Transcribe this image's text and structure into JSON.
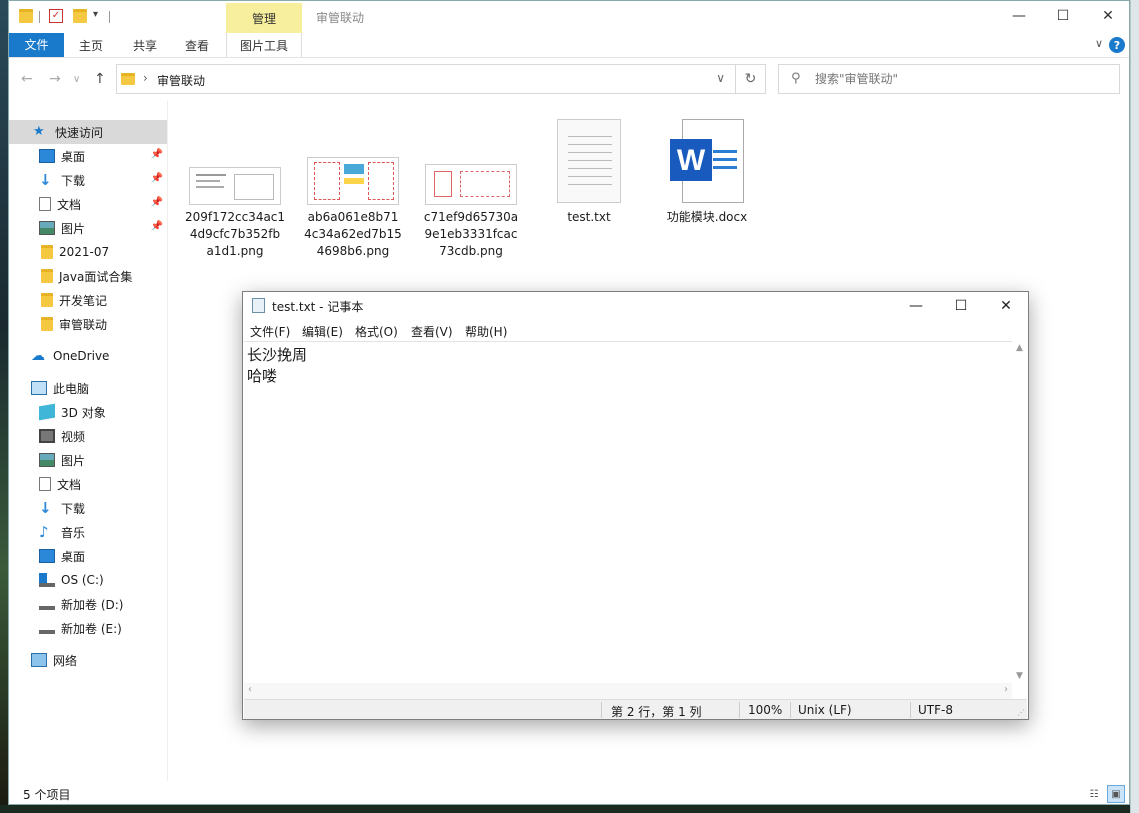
{
  "window": {
    "title": "审管联动",
    "manage_tab": "管理"
  },
  "ribbon": {
    "tabs": [
      "文件",
      "主页",
      "共享",
      "查看",
      "图片工具"
    ]
  },
  "address": {
    "crumb": "审管联动",
    "search_placeholder": "搜索\"审管联动\""
  },
  "nav": {
    "quick_access": "快速访问",
    "quick_items": [
      "桌面",
      "下载",
      "文档",
      "图片",
      "2021-07",
      "Java面试合集",
      "开发笔记",
      "审管联动"
    ],
    "onedrive": "OneDrive",
    "this_pc": "此电脑",
    "pc_items": [
      "3D 对象",
      "视频",
      "图片",
      "文档",
      "下载",
      "音乐",
      "桌面",
      "OS (C:)",
      "新加卷 (D:)",
      "新加卷 (E:)"
    ],
    "network": "网络"
  },
  "files": [
    {
      "name": "209f172cc34ac1\n4d9cfc7b352fb\na1d1.png",
      "line1": "209f172cc34ac1",
      "line2": "4d9cfc7b352fb",
      "line3": "a1d1.png",
      "icon": "image-thumbnail"
    },
    {
      "name": "ab6a061e8b71",
      "line1": "ab6a061e8b71",
      "line2": "4c34a62ed7b15",
      "line3": "4698b6.png",
      "icon": "image-thumbnail"
    },
    {
      "name": "c71ef9d65730a",
      "line1": "c71ef9d65730a",
      "line2": "9e1eb3331fcac",
      "line3": "73cdb.png",
      "icon": "image-thumbnail"
    },
    {
      "line1": "test.txt",
      "icon": "text-file-icon"
    },
    {
      "line1": "功能模块.docx",
      "icon": "word-doc-icon"
    }
  ],
  "status": {
    "count": "5 个项目"
  },
  "notepad": {
    "title": "test.txt - 记事本",
    "menu": [
      "文件(F)",
      "编辑(E)",
      "格式(O)",
      "查看(V)",
      "帮助(H)"
    ],
    "line1": "长沙挽周",
    "line2": "哈喽",
    "status_pos": "第 2 行，第 1 列",
    "status_zoom": "100%",
    "status_eol": "Unix (LF)",
    "status_enc": "UTF-8"
  },
  "colors": {
    "accent": "#1979ca",
    "manage_tab": "#f7ef9e",
    "word_blue": "#185abd"
  }
}
